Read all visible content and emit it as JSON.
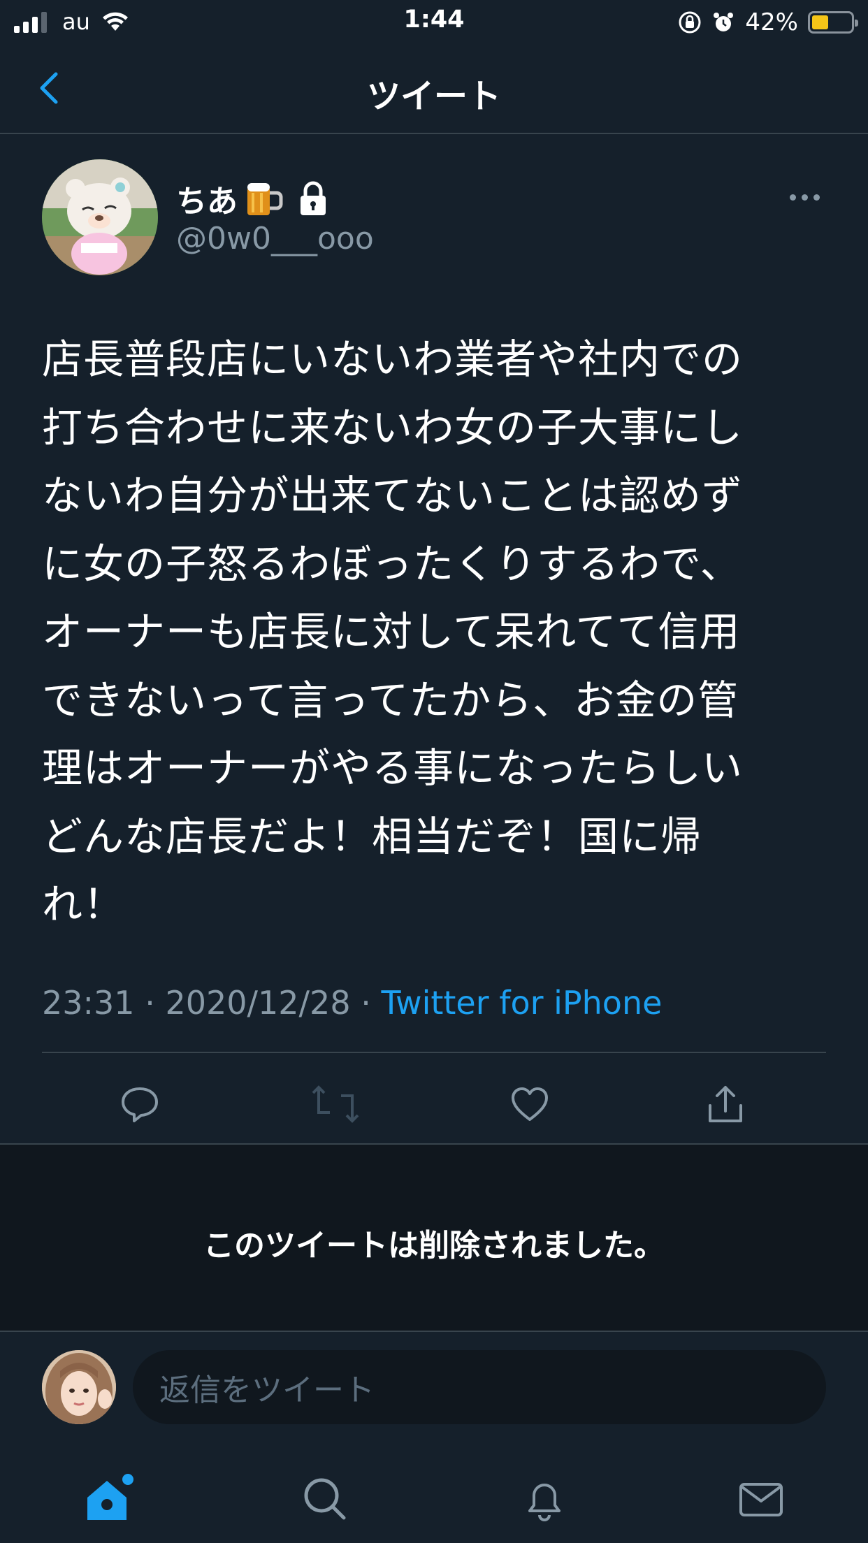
{
  "status_bar": {
    "carrier": "au",
    "time": "1:44",
    "battery_percent": "42%",
    "battery_level": 0.42
  },
  "nav": {
    "title": "ツイート"
  },
  "tweet": {
    "author_name": "ちあ",
    "handle": "@0w0___ooo",
    "text": "店長普段店にいないわ業者や社内での\n打ち合わせに来ないわ女の子大事にし\nないわ自分が出来てないことは認めず\nに女の子怒るわぼったくりするわで、\nオーナーも店長に対して呆れてて信用\nできないって言ってたから、お金の管\n理はオーナーがやる事になったらしい\nどんな店長だよ！相当だぞ！国に帰\nれ！",
    "time": "23:31",
    "separator1": "·",
    "date": "2020/12/28",
    "separator2": "·",
    "source": "Twitter for iPhone"
  },
  "deleted_notice": "このツイートは削除されました。",
  "reply": {
    "placeholder": "返信をツイート"
  },
  "colors": {
    "background": "#15202b",
    "accent": "#1da1f2",
    "secondary_text": "#8899a6",
    "divider": "#38444d"
  }
}
